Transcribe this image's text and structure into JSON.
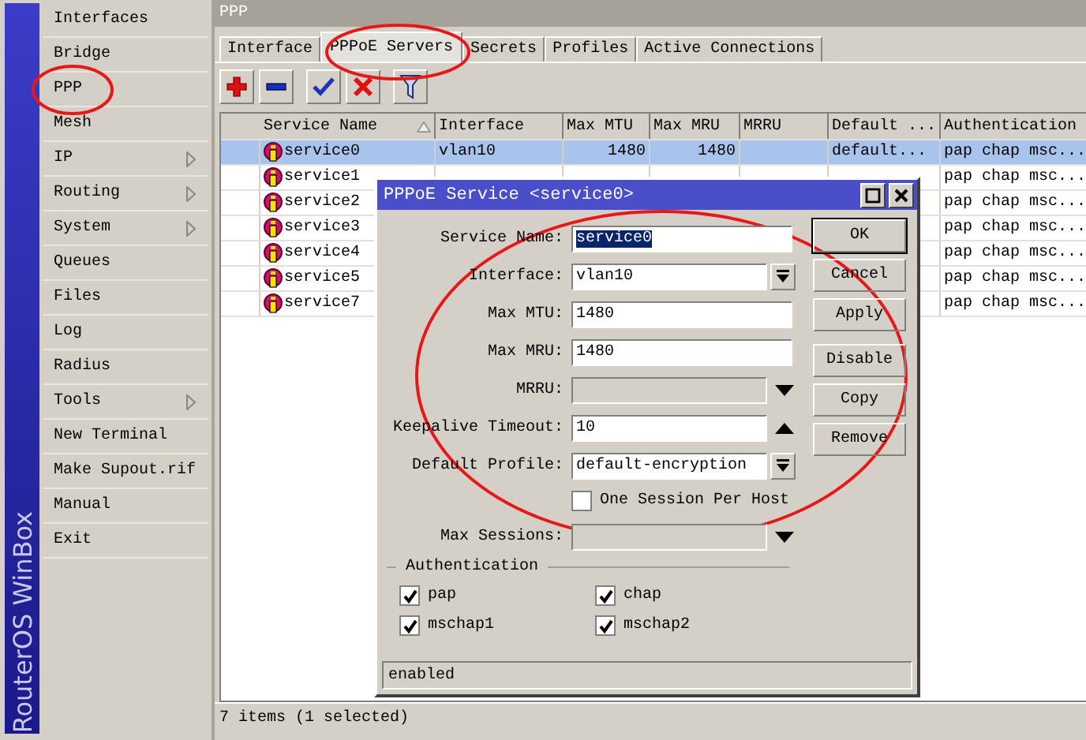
{
  "sidebar": {
    "brand": "RouterOS WinBox",
    "items": [
      {
        "label": "Interfaces",
        "submenu": false
      },
      {
        "label": "Bridge",
        "submenu": false
      },
      {
        "label": "PPP",
        "submenu": false
      },
      {
        "label": "Mesh",
        "submenu": false
      },
      {
        "label": "IP",
        "submenu": true
      },
      {
        "label": "Routing",
        "submenu": true
      },
      {
        "label": "System",
        "submenu": true
      },
      {
        "label": "Queues",
        "submenu": false
      },
      {
        "label": "Files",
        "submenu": false
      },
      {
        "label": "Log",
        "submenu": false
      },
      {
        "label": "Radius",
        "submenu": false
      },
      {
        "label": "Tools",
        "submenu": true
      },
      {
        "label": "New Terminal",
        "submenu": false
      },
      {
        "label": "Make Supout.rif",
        "submenu": false
      },
      {
        "label": "Manual",
        "submenu": false
      },
      {
        "label": "Exit",
        "submenu": false
      }
    ]
  },
  "window": {
    "title": "PPP",
    "tabs": [
      {
        "label": "Interface",
        "selected": false
      },
      {
        "label": "PPPoE Servers",
        "selected": true
      },
      {
        "label": "Secrets",
        "selected": false
      },
      {
        "label": "Profiles",
        "selected": false
      },
      {
        "label": "Active Connections",
        "selected": false
      }
    ]
  },
  "table": {
    "columns": [
      {
        "label": "Service Name",
        "sorted": true
      },
      {
        "label": "Interface",
        "sorted": false
      },
      {
        "label": "Max MTU",
        "sorted": false
      },
      {
        "label": "Max MRU",
        "sorted": false
      },
      {
        "label": "MRRU",
        "sorted": false
      },
      {
        "label": "Default ...",
        "sorted": false
      },
      {
        "label": "Authentication",
        "sorted": false
      }
    ],
    "rows": [
      {
        "selected": true,
        "name": "service0",
        "interface": "vlan10",
        "max_mtu": "1480",
        "max_mru": "1480",
        "default_profile": "default...",
        "authentication": "pap chap msc..."
      },
      {
        "selected": false,
        "name": "service1",
        "authentication": "pap chap msc..."
      },
      {
        "selected": false,
        "name": "service2",
        "authentication": "pap chap msc..."
      },
      {
        "selected": false,
        "name": "service3",
        "authentication": "pap chap msc..."
      },
      {
        "selected": false,
        "name": "service4",
        "authentication": "pap chap msc..."
      },
      {
        "selected": false,
        "name": "service5",
        "authentication": "pap chap msc..."
      },
      {
        "selected": false,
        "name": "service7",
        "authentication": "pap chap msc..."
      }
    ]
  },
  "status_bar": "7 items (1 selected)",
  "dialog": {
    "title": "PPPoE Service <service0>",
    "fields": [
      {
        "kind": "text",
        "label": "Service Name:",
        "value": "service0",
        "highlighted": true
      },
      {
        "kind": "select",
        "label": "Interface:",
        "value": "vlan10"
      },
      {
        "kind": "text",
        "label": "Max MTU:",
        "value": "1480",
        "highlighted": false
      },
      {
        "kind": "text",
        "label": "Max MRU:",
        "value": "1480",
        "highlighted": false
      },
      {
        "kind": "optional",
        "label": "MRRU:",
        "enabled": false
      },
      {
        "kind": "optional",
        "label": "Keepalive Timeout:",
        "value": "10",
        "enabled": true
      },
      {
        "kind": "select",
        "label": "Default Profile:",
        "value": "default-encryption"
      },
      {
        "kind": "checkbox",
        "label": "One Session Per Host",
        "checked": false
      },
      {
        "kind": "optional",
        "label": "Max Sessions:",
        "enabled": false
      }
    ],
    "button_groups": [
      [
        {
          "label": "OK",
          "default": true
        },
        {
          "label": "Cancel",
          "default": false
        },
        {
          "label": "Apply",
          "default": false
        }
      ],
      [
        {
          "label": "Disable",
          "default": false
        },
        {
          "label": "Copy",
          "default": false
        },
        {
          "label": "Remove",
          "default": false
        }
      ]
    ],
    "authentication": {
      "title": "Authentication",
      "options": [
        {
          "label": "pap",
          "checked": true
        },
        {
          "label": "chap",
          "checked": true
        },
        {
          "label": "mschap1",
          "checked": true
        },
        {
          "label": "mschap2",
          "checked": true
        }
      ]
    },
    "status": "enabled"
  }
}
